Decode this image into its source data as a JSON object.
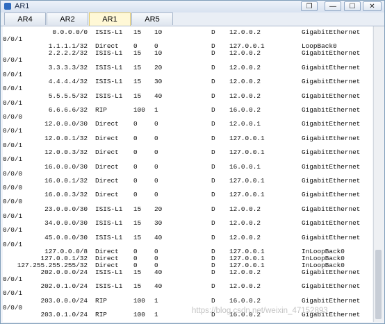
{
  "window": {
    "title": "AR1",
    "controls": [
      "❐",
      "—",
      "☐",
      "✕"
    ]
  },
  "tabs": [
    {
      "label": "AR4",
      "active": false
    },
    {
      "label": "AR2",
      "active": false
    },
    {
      "label": "AR1",
      "active": true
    },
    {
      "label": "AR5",
      "active": false
    }
  ],
  "routes": [
    {
      "dest": "0.0.0.0/0",
      "proto": "ISIS-L1",
      "pre": "15",
      "cost": "10",
      "flags": "D",
      "nexthop": "12.0.0.2",
      "iface": "GigabitEthernet",
      "cont": "0/0/1"
    },
    {
      "dest": "1.1.1.1/32",
      "proto": "Direct",
      "pre": "0",
      "cost": "0",
      "flags": "D",
      "nexthop": "127.0.0.1",
      "iface": "LoopBack0",
      "cont": ""
    },
    {
      "dest": "2.2.2.2/32",
      "proto": "ISIS-L1",
      "pre": "15",
      "cost": "10",
      "flags": "D",
      "nexthop": "12.0.0.2",
      "iface": "GigabitEthernet",
      "cont": "0/0/1"
    },
    {
      "dest": "3.3.3.3/32",
      "proto": "ISIS-L1",
      "pre": "15",
      "cost": "20",
      "flags": "D",
      "nexthop": "12.0.0.2",
      "iface": "GigabitEthernet",
      "cont": "0/0/1"
    },
    {
      "dest": "4.4.4.4/32",
      "proto": "ISIS-L1",
      "pre": "15",
      "cost": "30",
      "flags": "D",
      "nexthop": "12.0.0.2",
      "iface": "GigabitEthernet",
      "cont": "0/0/1"
    },
    {
      "dest": "5.5.5.5/32",
      "proto": "ISIS-L1",
      "pre": "15",
      "cost": "40",
      "flags": "D",
      "nexthop": "12.0.0.2",
      "iface": "GigabitEthernet",
      "cont": "0/0/1"
    },
    {
      "dest": "6.6.6.6/32",
      "proto": "RIP",
      "pre": "100",
      "cost": "1",
      "flags": "D",
      "nexthop": "16.0.0.2",
      "iface": "GigabitEthernet",
      "cont": "0/0/0"
    },
    {
      "dest": "12.0.0.0/30",
      "proto": "Direct",
      "pre": "0",
      "cost": "0",
      "flags": "D",
      "nexthop": "12.0.0.1",
      "iface": "GigabitEthernet",
      "cont": "0/0/1"
    },
    {
      "dest": "12.0.0.1/32",
      "proto": "Direct",
      "pre": "0",
      "cost": "0",
      "flags": "D",
      "nexthop": "127.0.0.1",
      "iface": "GigabitEthernet",
      "cont": "0/0/1"
    },
    {
      "dest": "12.0.0.3/32",
      "proto": "Direct",
      "pre": "0",
      "cost": "0",
      "flags": "D",
      "nexthop": "127.0.0.1",
      "iface": "GigabitEthernet",
      "cont": "0/0/1"
    },
    {
      "dest": "16.0.0.0/30",
      "proto": "Direct",
      "pre": "0",
      "cost": "0",
      "flags": "D",
      "nexthop": "16.0.0.1",
      "iface": "GigabitEthernet",
      "cont": "0/0/0"
    },
    {
      "dest": "16.0.0.1/32",
      "proto": "Direct",
      "pre": "0",
      "cost": "0",
      "flags": "D",
      "nexthop": "127.0.0.1",
      "iface": "GigabitEthernet",
      "cont": "0/0/0"
    },
    {
      "dest": "16.0.0.3/32",
      "proto": "Direct",
      "pre": "0",
      "cost": "0",
      "flags": "D",
      "nexthop": "127.0.0.1",
      "iface": "GigabitEthernet",
      "cont": "0/0/0"
    },
    {
      "dest": "23.0.0.0/30",
      "proto": "ISIS-L1",
      "pre": "15",
      "cost": "20",
      "flags": "D",
      "nexthop": "12.0.0.2",
      "iface": "GigabitEthernet",
      "cont": "0/0/1"
    },
    {
      "dest": "34.0.0.0/30",
      "proto": "ISIS-L1",
      "pre": "15",
      "cost": "30",
      "flags": "D",
      "nexthop": "12.0.0.2",
      "iface": "GigabitEthernet",
      "cont": "0/0/1"
    },
    {
      "dest": "45.0.0.0/30",
      "proto": "ISIS-L1",
      "pre": "15",
      "cost": "40",
      "flags": "D",
      "nexthop": "12.0.0.2",
      "iface": "GigabitEthernet",
      "cont": "0/0/1"
    },
    {
      "dest": "127.0.0.0/8",
      "proto": "Direct",
      "pre": "0",
      "cost": "0",
      "flags": "D",
      "nexthop": "127.0.0.1",
      "iface": "InLoopBack0",
      "cont": ""
    },
    {
      "dest": "127.0.0.1/32",
      "proto": "Direct",
      "pre": "0",
      "cost": "0",
      "flags": "D",
      "nexthop": "127.0.0.1",
      "iface": "InLoopBack0",
      "cont": ""
    },
    {
      "dest": "127.255.255.255/32",
      "proto": "Direct",
      "pre": "0",
      "cost": "0",
      "flags": "D",
      "nexthop": "127.0.0.1",
      "iface": "InLoopBack0",
      "cont": ""
    },
    {
      "dest": "202.0.0.0/24",
      "proto": "ISIS-L1",
      "pre": "15",
      "cost": "40",
      "flags": "D",
      "nexthop": "12.0.0.2",
      "iface": "GigabitEthernet",
      "cont": "0/0/1"
    },
    {
      "dest": "202.0.1.0/24",
      "proto": "ISIS-L1",
      "pre": "15",
      "cost": "40",
      "flags": "D",
      "nexthop": "12.0.0.2",
      "iface": "GigabitEthernet",
      "cont": "0/0/1"
    },
    {
      "dest": "203.0.0.0/24",
      "proto": "RIP",
      "pre": "100",
      "cost": "1",
      "flags": "D",
      "nexthop": "16.0.0.2",
      "iface": "GigabitEthernet",
      "cont": "0/0/0"
    },
    {
      "dest": "203.0.1.0/24",
      "proto": "RIP",
      "pre": "100",
      "cost": "1",
      "flags": "D",
      "nexthop": "16.0.0.2",
      "iface": "GigabitEthernet",
      "cont": ""
    }
  ],
  "watermark": "https://blog.csdn.net/weixin_47152893",
  "colors": {
    "active_tab": "#fff8d6",
    "console_bg": "#ffffff"
  }
}
